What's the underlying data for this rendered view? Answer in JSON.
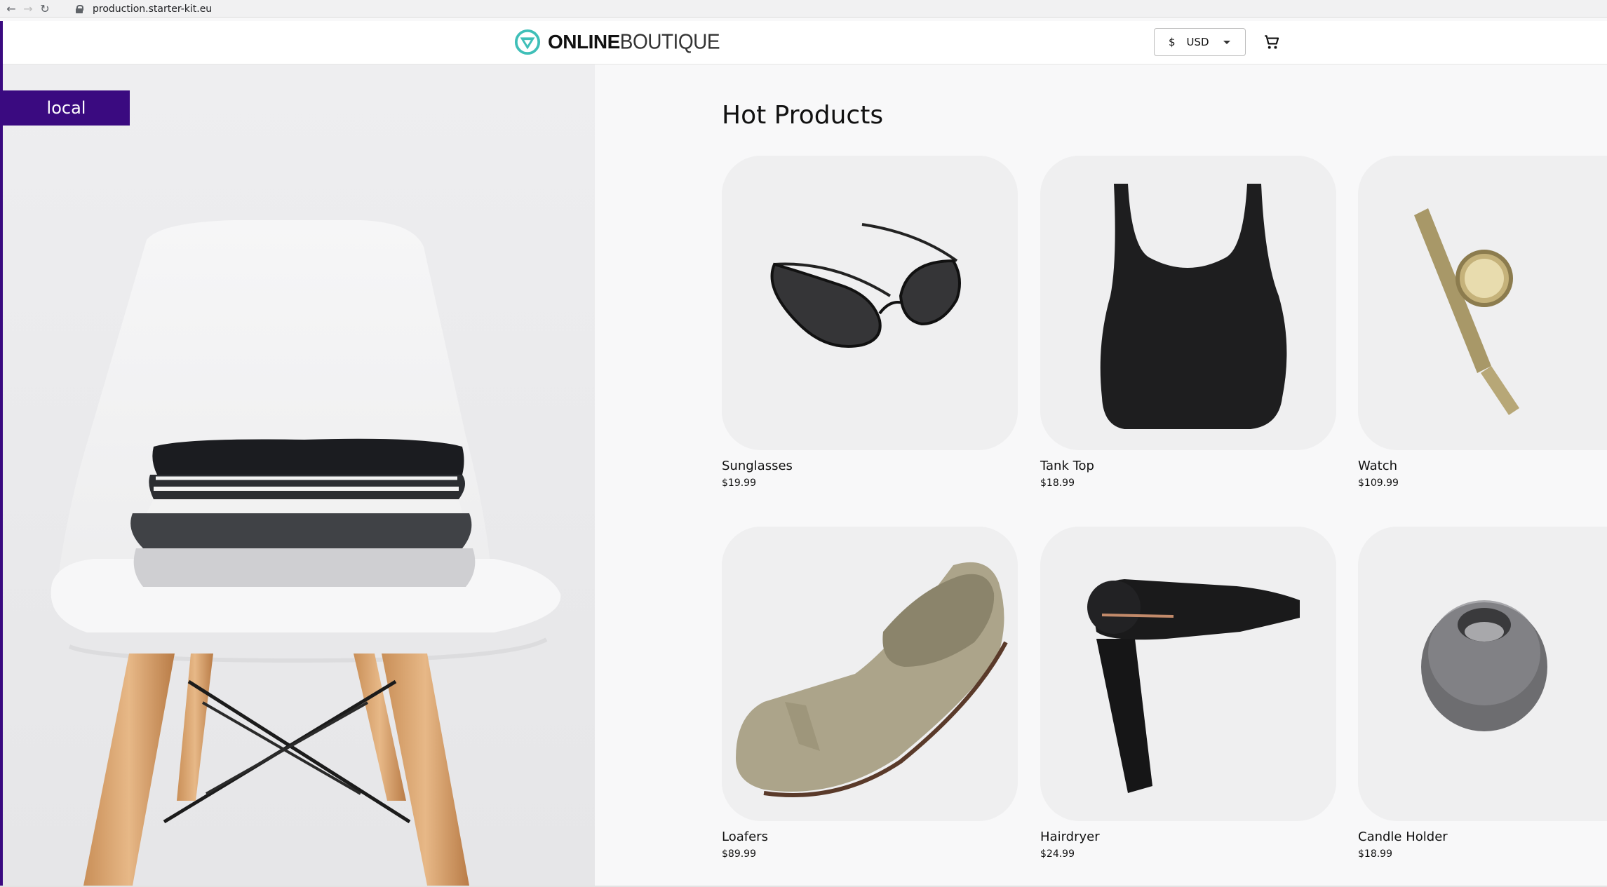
{
  "browser": {
    "url": "production.starter-kit.eu"
  },
  "header": {
    "logo_bold": "ONLINE",
    "logo_light": "BOUTIQUE",
    "currency_symbol": "$",
    "currency_code": "USD",
    "accent_color": "#3fbfb8"
  },
  "hero": {
    "env_badge": "local",
    "badge_color": "#3a0a80"
  },
  "products": {
    "title": "Hot Products",
    "items": [
      {
        "name": "Sunglasses",
        "price": "$19.99"
      },
      {
        "name": "Tank Top",
        "price": "$18.99"
      },
      {
        "name": "Watch",
        "price": "$109.99"
      },
      {
        "name": "Loafers",
        "price": "$89.99"
      },
      {
        "name": "Hairdryer",
        "price": "$24.99"
      },
      {
        "name": "Candle Holder",
        "price": "$18.99"
      }
    ]
  }
}
